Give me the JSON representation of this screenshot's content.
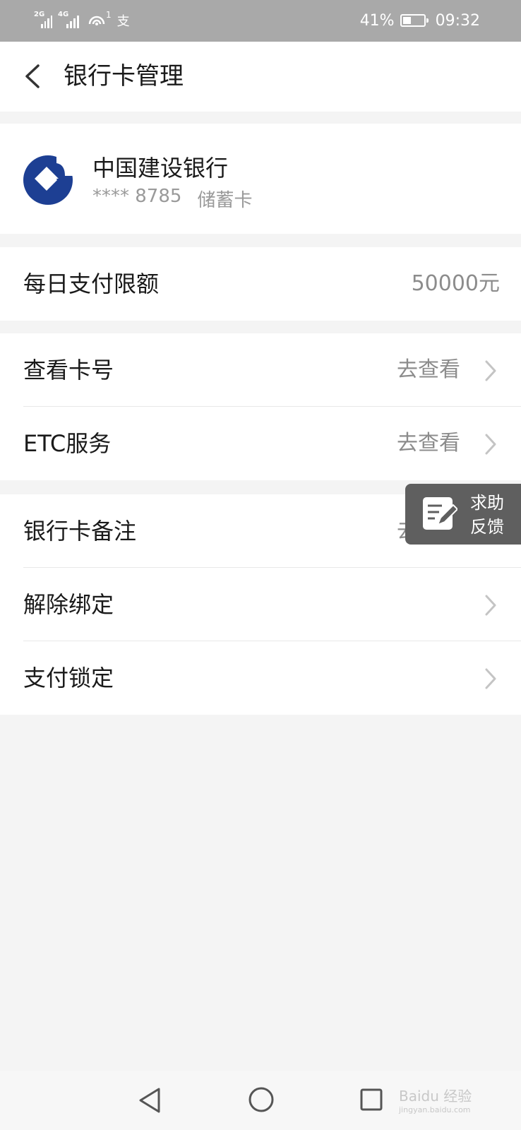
{
  "status_bar": {
    "signal1": "2G",
    "signal2": "4G",
    "wifi_badge": "1",
    "app_icon_text": "支",
    "battery_percent": "41%",
    "battery_level": 0.41,
    "time": "09:32"
  },
  "header": {
    "title": "银行卡管理"
  },
  "card": {
    "bank_name": "中国建设银行",
    "masked_number": "**** 8785",
    "card_type": "储蓄卡",
    "logo_color": "#1d3f93"
  },
  "limit": {
    "label": "每日支付限额",
    "value": "50000元"
  },
  "section_view": [
    {
      "label": "查看卡号",
      "action": "去查看"
    },
    {
      "label": "ETC服务",
      "action": "去查看"
    }
  ],
  "section_manage": [
    {
      "label": "银行卡备注",
      "action": "去备注"
    },
    {
      "label": "解除绑定",
      "action": ""
    },
    {
      "label": "支付锁定",
      "action": ""
    }
  ],
  "floating_help": {
    "line1": "求助",
    "line2": "反馈"
  },
  "watermark": {
    "brand": "Baidu 经验",
    "url": "jingyan.baidu.com"
  },
  "icons": [
    "back-arrow-icon",
    "chevron-right-icon",
    "edit-note-icon",
    "nav-back-icon",
    "nav-home-icon",
    "nav-recent-icon"
  ]
}
